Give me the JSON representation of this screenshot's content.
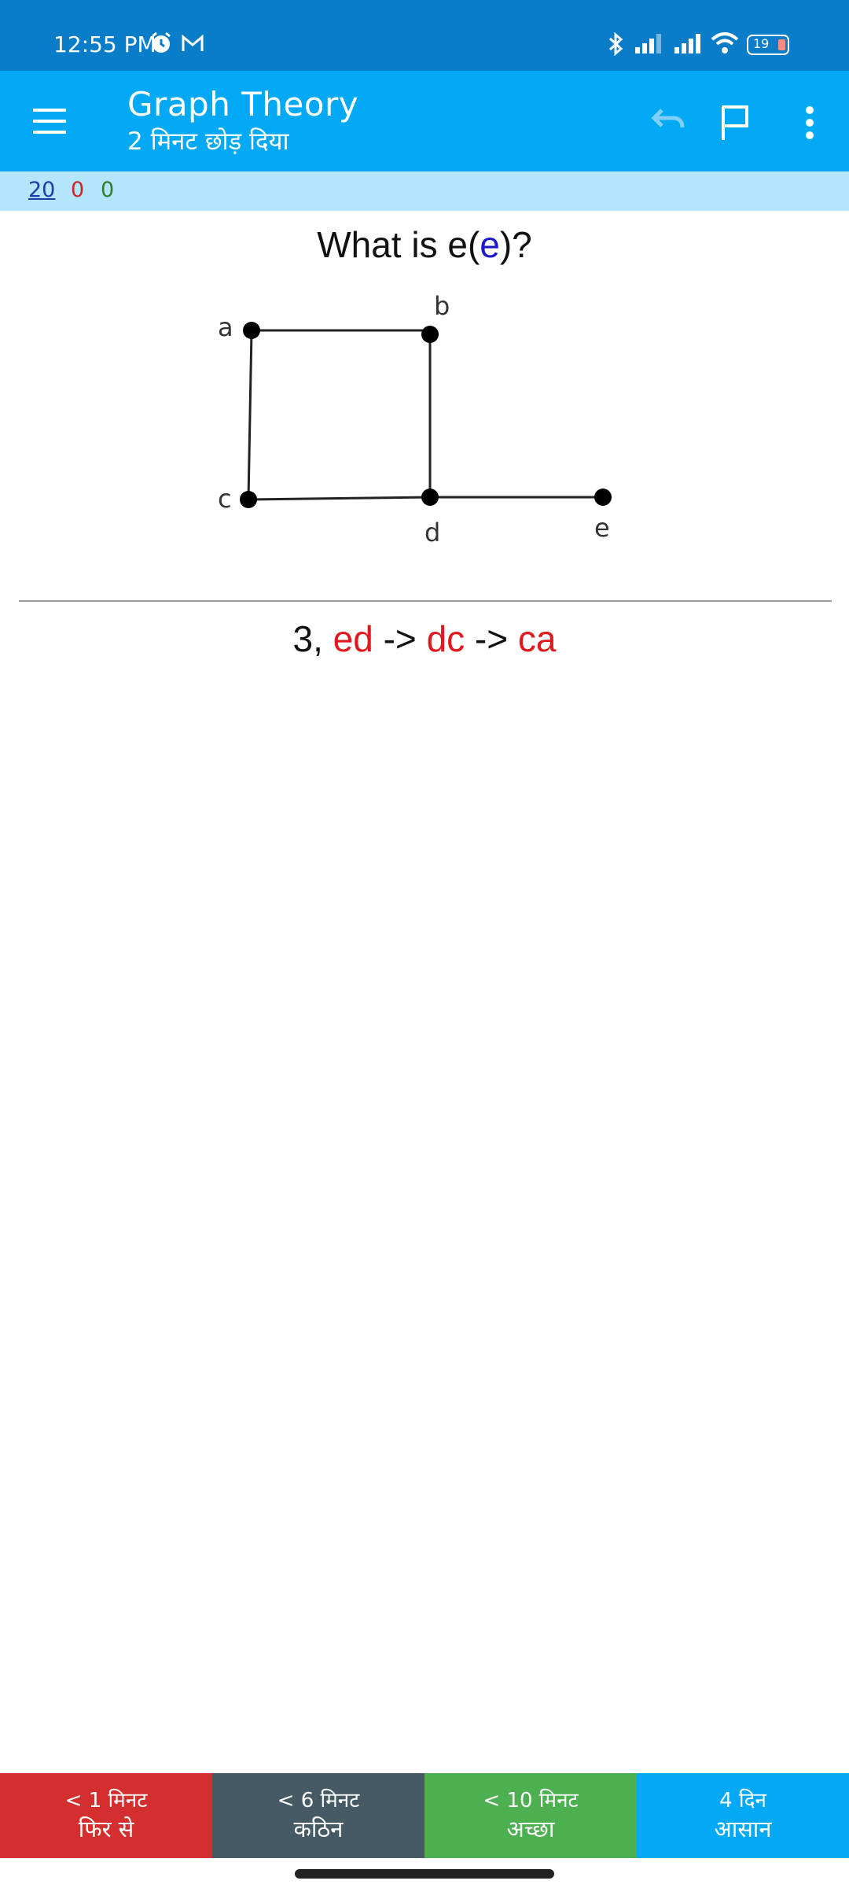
{
  "status_bar": {
    "time": "12:55 PM",
    "battery": "19",
    "icons": [
      "alarm-icon",
      "gmail-icon",
      "bluetooth-icon",
      "signal-icon",
      "signal-icon",
      "wifi-icon",
      "battery-icon"
    ]
  },
  "app_bar": {
    "title": "Graph Theory",
    "subtitle": "2 मिनट छोड़ दिया",
    "icons": [
      "menu-icon",
      "undo-icon",
      "flag-icon",
      "more-vert-icon"
    ]
  },
  "counts": {
    "new": "20",
    "learning": "0",
    "review": "0"
  },
  "card": {
    "question_prefix": "What is e(",
    "question_var": "e",
    "question_suffix": ")?",
    "graph_labels": {
      "a": "a",
      "b": "b",
      "c": "c",
      "d": "d",
      "e": "e"
    },
    "answer_prefix": "3, ",
    "answer_part1": "ed",
    "answer_arrow1": " -> ",
    "answer_part2": "dc",
    "answer_arrow2": " -> ",
    "answer_part3": "ca"
  },
  "ease_buttons": [
    {
      "time": "< 1 मिनट",
      "label": "फिर से"
    },
    {
      "time": "< 6 मिनट",
      "label": "कठिन"
    },
    {
      "time": "< 10 मिनट",
      "label": "अच्छा"
    },
    {
      "time": "4 दिन",
      "label": "आसान"
    }
  ],
  "colors": {
    "status_bar": "#0a7dc9",
    "app_bar": "#03a9f4",
    "counts_bar": "#b3e5fc",
    "again": "#d32f2f",
    "hard": "#455a64",
    "good": "#4caf50",
    "easy": "#03a9f4",
    "answer_red": "#e0191e",
    "question_var_blue": "#1a1acb"
  }
}
